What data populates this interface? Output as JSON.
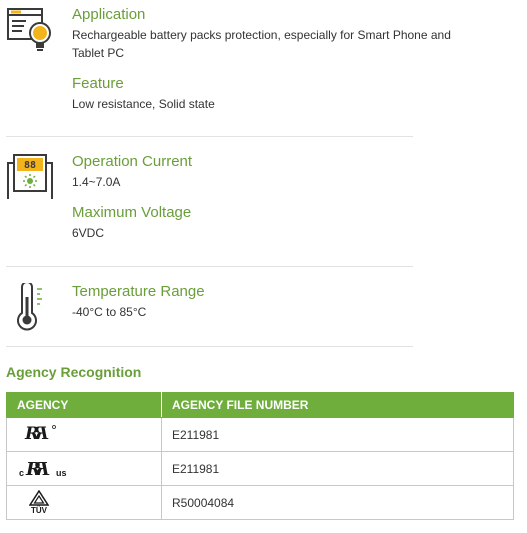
{
  "specs": {
    "application": {
      "icon": "application-lightbulb-icon",
      "title": "Application",
      "value": "Rechargeable battery packs protection, especially for Smart Phone and Tablet PC"
    },
    "feature": {
      "title": "Feature",
      "value": "Low resistance, Solid state"
    },
    "operation_current": {
      "icon": "meter-icon",
      "title": "Operation Current",
      "value": "1.4~7.0A"
    },
    "maximum_voltage": {
      "title": "Maximum Voltage",
      "value": "6VDC"
    },
    "temperature_range": {
      "icon": "thermometer-icon",
      "title": "Temperature Range",
      "value": "-40°C to 85°C"
    }
  },
  "agency": {
    "heading": "Agency Recognition",
    "columns": [
      "AGENCY",
      "AGENCY FILE NUMBER"
    ],
    "rows": [
      {
        "mark": "ul-recognized-mark",
        "file_number": "E211981"
      },
      {
        "mark": "cul-us-recognized-mark",
        "mark_text_c": "c",
        "mark_text_us": "us",
        "file_number": "E211981"
      },
      {
        "mark": "tuv-mark",
        "mark_text": "TÜV",
        "file_number": "R50004084"
      }
    ]
  },
  "colors": {
    "accent_green": "#6a9e3a",
    "header_green": "#6fae3d",
    "icon_yellow": "#f2b31b",
    "icon_dark": "#3a3a3a"
  }
}
